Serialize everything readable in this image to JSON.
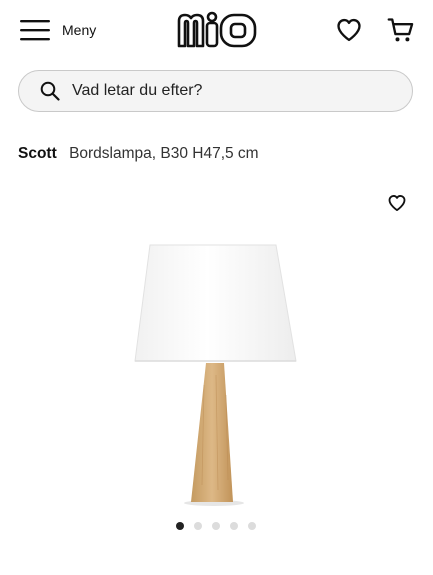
{
  "header": {
    "menu_label": "Meny",
    "logo_text": "mio"
  },
  "search": {
    "placeholder": "Vad letar du efter?"
  },
  "product": {
    "brand": "Scott",
    "name": "Bordslampa, B30 H47,5 cm"
  },
  "carousel": {
    "image_count": 5,
    "active_index": 0
  },
  "icons": {
    "menu": "hamburger-icon",
    "wishlist": "heart-icon",
    "cart": "cart-icon",
    "search": "search-icon",
    "favorite": "heart-outline-icon"
  },
  "colors": {
    "text": "#111111",
    "search_bg": "#f4f4f4",
    "dot_active": "#222222",
    "dot_inactive": "#dcdcdc"
  }
}
